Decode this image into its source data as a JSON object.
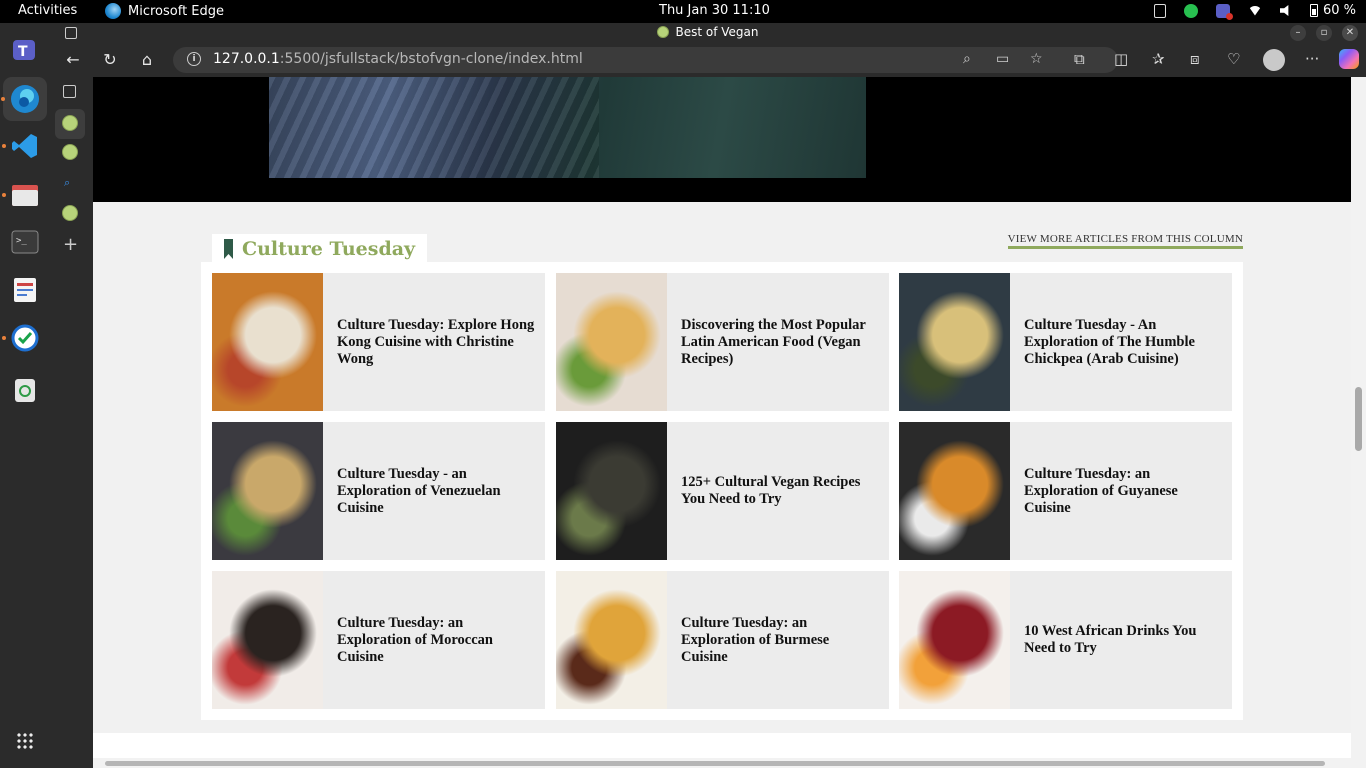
{
  "topbar": {
    "activities": "Activities",
    "app_name": "Microsoft Edge",
    "clock": "Thu Jan 30  11:10",
    "battery": "60 %"
  },
  "browser": {
    "tab_title": "Best of Vegan",
    "url_host": "127.0.0.1",
    "url_path": ":5500/jsfullstack/bstofvgn-clone/index.html"
  },
  "section": {
    "title": "Culture Tuesday",
    "view_more": "VIEW MORE ARTICLES FROM THIS COLUMN"
  },
  "cards": [
    {
      "title": "Culture Tuesday: Explore Hong Kong Cuisine with Christine Wong",
      "colors": [
        "#c97a2a",
        "#e9e0cf",
        "#b7462a"
      ]
    },
    {
      "title": "Discovering the Most Popular Latin American Food (Vegan Recipes)",
      "colors": [
        "#e6dcd2",
        "#e3b25a",
        "#6a9b3a"
      ]
    },
    {
      "title": "Culture Tuesday - An Exploration of The Humble Chickpea (Arab Cuisine)",
      "colors": [
        "#2f3b44",
        "#d8c07a",
        "#3c4a2a"
      ]
    },
    {
      "title": "Culture Tuesday - an Exploration of Venezuelan Cuisine",
      "colors": [
        "#3b3a40",
        "#c9a86a",
        "#5a8a3a"
      ]
    },
    {
      "title": "125+ Cultural Vegan Recipes You Need to Try",
      "colors": [
        "#1e1e1e",
        "#3b3b33",
        "#6b7a4a"
      ]
    },
    {
      "title": "Culture Tuesday: an Exploration of Guyanese Cuisine",
      "colors": [
        "#2a2a2a",
        "#d98a2a",
        "#eaeaea"
      ]
    },
    {
      "title": "Culture Tuesday: an Exploration of Moroccan Cuisine",
      "colors": [
        "#f1ece8",
        "#2a2320",
        "#c23a3a"
      ]
    },
    {
      "title": "Culture Tuesday: an Exploration of Burmese Cuisine",
      "colors": [
        "#f3efe6",
        "#e0a43a",
        "#5a2a1a"
      ]
    },
    {
      "title": "10 West African Drinks You Need to Try",
      "colors": [
        "#f4f0ec",
        "#8c1a24",
        "#f2a13a"
      ]
    }
  ]
}
